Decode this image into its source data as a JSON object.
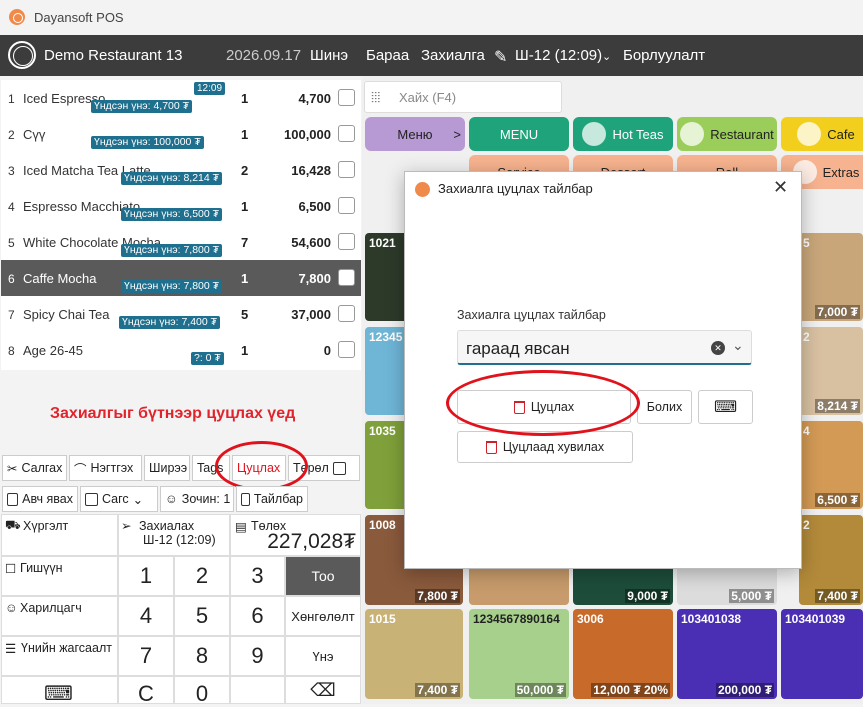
{
  "app": {
    "title": "Dayansoft POS"
  },
  "nav": {
    "restaurant": "Demo Restaurant 13",
    "date": "2026.09.17",
    "items": [
      "Шинэ",
      "Бараа",
      "Захиалга",
      "Ш-12 (12:09)",
      "Борлуулалт"
    ]
  },
  "order_time": "12:09",
  "orders": [
    {
      "no": "1",
      "name": "Iced Espresso",
      "base": "Үндсэн үнэ: 4,700 ₮",
      "qty": "1",
      "amount": "4,700"
    },
    {
      "no": "2",
      "name": "Сүү",
      "base": "Үндсэн үнэ: 100,000 ₮",
      "qty": "1",
      "amount": "100,000"
    },
    {
      "no": "3",
      "name": "Iced Matcha Tea Latte",
      "base": "Үндсэн үнэ: 8,214 ₮",
      "qty": "2",
      "amount": "16,428"
    },
    {
      "no": "4",
      "name": "Espresso Macchiato",
      "base": "Үндсэн үнэ: 6,500 ₮",
      "qty": "1",
      "amount": "6,500"
    },
    {
      "no": "5",
      "name": "White  Chocolate Mocha",
      "base": "Үндсэн үнэ: 7,800 ₮",
      "qty": "7",
      "amount": "54,600"
    },
    {
      "no": "6",
      "name": "Caffe Mocha",
      "base": "Үндсэн үнэ: 7,800 ₮",
      "qty": "1",
      "amount": "7,800"
    },
    {
      "no": "7",
      "name": "Spicy Chai Tea",
      "base": "Үндсэн үнэ: 7,400 ₮",
      "qty": "5",
      "amount": "37,000"
    },
    {
      "no": "8",
      "name": "Age 26-45",
      "base": "?: 0 ₮",
      "qty": "1",
      "amount": "0"
    }
  ],
  "notice": "Захиалгыг бүтнээр цуцлах үед",
  "toolbar1": [
    "Салгах",
    "Нэгтгэх",
    "Ширээ",
    "Tags",
    "Цуцлах",
    "Төрөл"
  ],
  "toolbar2": [
    "Авч явах",
    "Сагс",
    "Зочин: 1",
    "Тайлбар"
  ],
  "pad": {
    "delivery": "Хүргэлт",
    "send": "Захиалах",
    "send_sub": "Ш-12 (12:09)",
    "total_label": "Төлөх",
    "total": "227,028₮",
    "member": "Гишүүн",
    "customer": "Харилцагч",
    "price_list": "Үнийн жагсаалт",
    "keys": [
      "1",
      "2",
      "3",
      "4",
      "5",
      "6",
      "7",
      "8",
      "9",
      "C",
      "0"
    ],
    "qty_btn": "Тоо",
    "discount_btn": "Хөнгөлөлт",
    "price_btn": "Үнэ"
  },
  "search": {
    "placeholder": "Хайх (F4)"
  },
  "categories": [
    {
      "label": "Меню",
      "color": "#b79ad4"
    },
    {
      "label": "MENU",
      "color": "#1fa37a"
    },
    {
      "label": "Hot Teas",
      "color": "#1fa37a"
    },
    {
      "label": "Restaurant",
      "color": "#9acd5a"
    },
    {
      "label": "Cafe",
      "color": "#f2cf1d"
    }
  ],
  "subcategories": [
    "Service",
    "Dessert",
    "Roll",
    "Extras"
  ],
  "products": [
    {
      "code": "1021",
      "price": "",
      "color": "#2d3a2a"
    },
    {
      "code": "5",
      "price": "7,000 ₮",
      "color": "#c9a67a"
    },
    {
      "code": "12345",
      "price": "",
      "color": "#6fb5d6"
    },
    {
      "code": "2",
      "price": "8,214 ₮",
      "color": "#d8c1a1"
    },
    {
      "code": "1035",
      "price": "",
      "color": "#7fa03a"
    },
    {
      "code": "4",
      "price": "6,500 ₮",
      "color": "#d39a55"
    },
    {
      "code": "1008",
      "price": "7,800 ₮",
      "color": "#8a5a3c"
    },
    {
      "code": "",
      "price": "",
      "color": "#c79b6b"
    },
    {
      "code": "",
      "price": "9,000 ₮",
      "color": "#1d4d3a"
    },
    {
      "code": "",
      "price": "5,000 ₮",
      "color": "#dcdcdc"
    },
    {
      "code": "2",
      "price": "7,400 ₮",
      "color": "#b38a3a"
    },
    {
      "code": "1015",
      "price": "7,400 ₮",
      "color": "#c9b275"
    },
    {
      "code": "1234567890164",
      "price": "50,000 ₮",
      "color": "#a8d08d"
    },
    {
      "code": "3006",
      "price": "12,000 ₮ 20%",
      "color": "#c76a2a"
    },
    {
      "code": "103401038",
      "price": "200,000 ₮",
      "color": "#4a2fb5"
    },
    {
      "code": "103401039",
      "price": "",
      "color": "#4a2fb5"
    }
  ],
  "dialog": {
    "title": "Захиалга цуцлах тайлбар",
    "field_label": "Захиалга цуцлах тайлбар",
    "value": "гараад явсан",
    "cancel_order": "Цуцлах",
    "cancel_btn": "Болих",
    "cancel_copy": "Цуцлаад хувилах"
  },
  "accent": "#1f6f8f",
  "highlight": "#e0121c"
}
